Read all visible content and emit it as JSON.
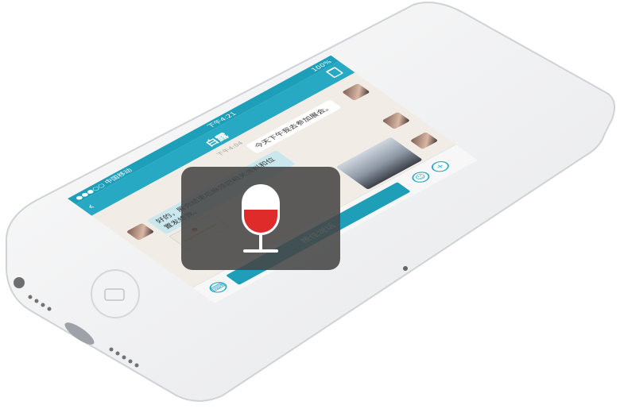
{
  "status": {
    "carrier": "●●●○○ 中国移动",
    "wifi_icon": "wifi-icon",
    "time": "下午4:21",
    "battery": "100%"
  },
  "nav": {
    "back_icon": "chevron-left-icon",
    "title": "白露",
    "trash_icon": "trash-icon"
  },
  "chat": {
    "timestamp": "下午4:04",
    "messages": [
      {
        "side": "right",
        "text": "今天下午我去参加展会。"
      },
      {
        "side": "left",
        "text": "好的，展会结束后麻烦把相关资料和位置发给我。"
      }
    ],
    "map_label": "位置",
    "photo_label": "照片"
  },
  "bottom": {
    "keyboard_icon": "keyboard-icon",
    "talk_label": "按住说话",
    "emoji_icon": "emoji-icon",
    "plus_icon": "plus-icon"
  },
  "record": {
    "mic_icon": "microphone-icon",
    "level": 0.5,
    "accent": "#e02b2b"
  },
  "colors": {
    "brand": "#28a9c3",
    "status": "#1d9fba"
  }
}
